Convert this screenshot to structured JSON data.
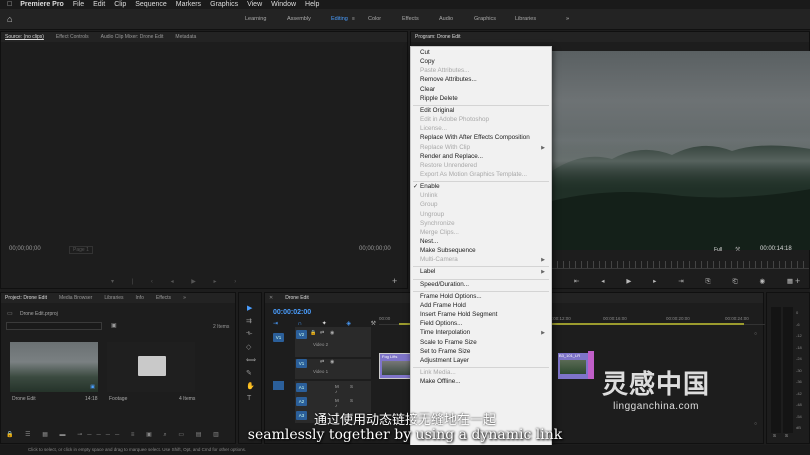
{
  "menubar": {
    "app": "Premiere Pro",
    "items": [
      "File",
      "Edit",
      "Clip",
      "Sequence",
      "Markers",
      "Graphics",
      "View",
      "Window",
      "Help"
    ]
  },
  "workspaces": {
    "items": [
      {
        "label": "Learning",
        "active": false
      },
      {
        "label": "Assembly",
        "active": false
      },
      {
        "label": "Editing",
        "active": true
      },
      {
        "label": "Color",
        "active": false
      },
      {
        "label": "Effects",
        "active": false
      },
      {
        "label": "Audio",
        "active": false
      },
      {
        "label": "Graphics",
        "active": false
      },
      {
        "label": "Libraries",
        "active": false
      }
    ],
    "more": "»"
  },
  "source_panel": {
    "tabs": [
      "Source: (no clips)",
      "Effect Controls",
      "Audio Clip Mixer: Drone Edit",
      "Metadata"
    ],
    "tc_left": "00;00;00;00",
    "page": "Page 1",
    "tc_right": "00;00;00;00"
  },
  "program_panel": {
    "tab": "Program: Drone Edit",
    "fit": "Full",
    "timecode": "00:00:14:18"
  },
  "project_panel": {
    "tabs": [
      "Project: Drone Edit",
      "Media Browser",
      "Libraries",
      "Info",
      "Effects"
    ],
    "project_file": "Drone Edit.prproj",
    "item_count": "2 Items",
    "items": [
      {
        "name": "Drone Edit",
        "meta": "14:18"
      },
      {
        "name": "Footage",
        "meta": "4 Items"
      }
    ]
  },
  "timeline": {
    "tab": "Drone Edit",
    "timecode": "00:00:02:00",
    "ruler": [
      "00:00",
      "00:00:08:00",
      "00:00:12:00",
      "00:00:16:00",
      "00:00:20:00",
      "00:00:24:00"
    ],
    "tracks": [
      {
        "id": "V2",
        "name": "Video 2"
      },
      {
        "id": "V1",
        "name": "Video 1"
      },
      {
        "id": "A1",
        "name": ""
      },
      {
        "id": "A2",
        "name": ""
      },
      {
        "id": "A3",
        "name": ""
      }
    ],
    "src_v1": "V1",
    "clip1_label": "Fog Lifts",
    "clip2_label": "B3_101_LR"
  },
  "audio_meter": {
    "scale": [
      "0",
      "-6",
      "-12",
      "-18",
      "-24",
      "-30",
      "-36",
      "-42",
      "-48",
      "-54",
      "dB"
    ],
    "bottom": [
      "S",
      "S"
    ]
  },
  "context_menu": {
    "items": [
      {
        "label": "Cut",
        "enabled": true
      },
      {
        "label": "Copy",
        "enabled": true
      },
      {
        "label": "Paste Attributes...",
        "enabled": false
      },
      {
        "label": "Remove Attributes...",
        "enabled": true
      },
      {
        "label": "Clear",
        "enabled": true
      },
      {
        "label": "Ripple Delete",
        "enabled": true
      },
      {
        "sep": true
      },
      {
        "label": "Edit Original",
        "enabled": true
      },
      {
        "label": "Edit in Adobe Photoshop",
        "enabled": false
      },
      {
        "label": "License...",
        "enabled": false
      },
      {
        "label": "Replace With After Effects Composition",
        "enabled": true
      },
      {
        "label": "Replace With Clip",
        "enabled": false,
        "submenu": true
      },
      {
        "label": "Render and Replace...",
        "enabled": true
      },
      {
        "label": "Restore Unrendered",
        "enabled": false
      },
      {
        "label": "Export As Motion Graphics Template...",
        "enabled": false
      },
      {
        "sep": true
      },
      {
        "label": "Enable",
        "enabled": true,
        "checked": true
      },
      {
        "label": "Unlink",
        "enabled": false
      },
      {
        "label": "Group",
        "enabled": false
      },
      {
        "label": "Ungroup",
        "enabled": false
      },
      {
        "label": "Synchronize",
        "enabled": false
      },
      {
        "label": "Merge Clips...",
        "enabled": false
      },
      {
        "label": "Nest...",
        "enabled": true
      },
      {
        "label": "Make Subsequence",
        "enabled": true
      },
      {
        "label": "Multi-Camera",
        "enabled": false,
        "submenu": true
      },
      {
        "sep": true
      },
      {
        "label": "Label",
        "enabled": true,
        "submenu": true
      },
      {
        "sep": true
      },
      {
        "label": "Speed/Duration...",
        "enabled": true
      },
      {
        "sep": true
      },
      {
        "label": "Frame Hold Options...",
        "enabled": true
      },
      {
        "label": "Add Frame Hold",
        "enabled": true
      },
      {
        "label": "Insert Frame Hold Segment",
        "enabled": true
      },
      {
        "label": "Field Options...",
        "enabled": true
      },
      {
        "label": "Time Interpolation",
        "enabled": true,
        "submenu": true
      },
      {
        "label": "Scale to Frame Size",
        "enabled": true
      },
      {
        "label": "Set to Frame Size",
        "enabled": true
      },
      {
        "label": "Adjustment Layer",
        "enabled": true
      },
      {
        "sep": true
      },
      {
        "label": "Link Media...",
        "enabled": false
      },
      {
        "label": "Make Offline...",
        "enabled": true
      }
    ]
  },
  "subtitles": {
    "cn": "通过使用动态链接无缝地在一起",
    "en": "seamlessly together by using a dynamic link"
  },
  "watermark": {
    "cn": "灵感中国",
    "en": "lingganchina.com"
  },
  "statusbar": "Click to select, or click in empty space and drag to marquee select. Use Shift, Opt, and Cmd for other options.",
  "colors": {
    "accent": "#4a9eff",
    "clip_v1": "#7e74c9",
    "clip_pink": "#c05ec8",
    "menu_bg": "#f1f1f1"
  }
}
